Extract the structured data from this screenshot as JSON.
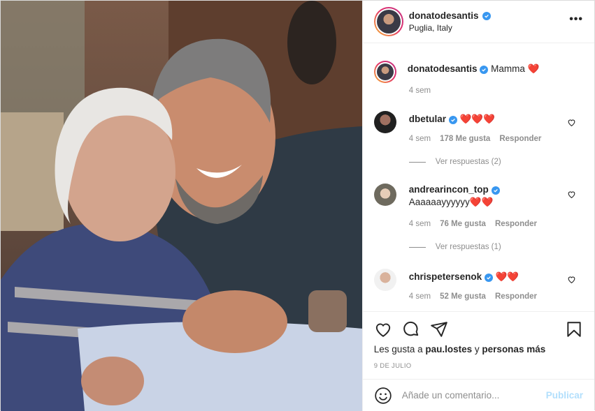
{
  "post": {
    "author": "donatodesantis",
    "location": "Puglia, Italy",
    "caption_user": "donatodesantis",
    "caption_text": "Mamma",
    "caption_emoji": "❤️",
    "caption_time": "4 sem"
  },
  "comments": [
    {
      "user": "dbetular",
      "text": "",
      "emoji": "❤️❤️❤️",
      "time": "4 sem",
      "likes": "178 Me gusta",
      "reply": "Responder",
      "view_replies": "Ver respuestas (2)",
      "verified": true
    },
    {
      "user": "andrearincon_top",
      "text": "Aaaaaayyyyyy",
      "emoji": "❤️❤️",
      "time": "4 sem",
      "likes": "76 Me gusta",
      "reply": "Responder",
      "view_replies": "Ver respuestas (1)",
      "verified": true
    },
    {
      "user": "chrispetersenok",
      "text": "",
      "emoji": "❤️❤️",
      "time": "4 sem",
      "likes": "52 Me gusta",
      "reply": "Responder",
      "view_replies": "",
      "verified": true
    }
  ],
  "likes": {
    "prefix": "Les gusta a",
    "user": "pau.lostes",
    "middle": "y",
    "suffix": "personas más"
  },
  "date": "9 DE JULIO",
  "comment_box": {
    "placeholder": "Añade un comentario...",
    "publish": "Publicar"
  },
  "icons": [
    "more-icon",
    "verified-icon",
    "heart-icon",
    "comment-icon",
    "share-icon",
    "bookmark-icon",
    "emoji-icon"
  ],
  "colors": {
    "verified": "#3897f0",
    "heart_red": "#e0245e",
    "muted": "#8e8e8e",
    "publish_disabled": "#b2dffc"
  }
}
